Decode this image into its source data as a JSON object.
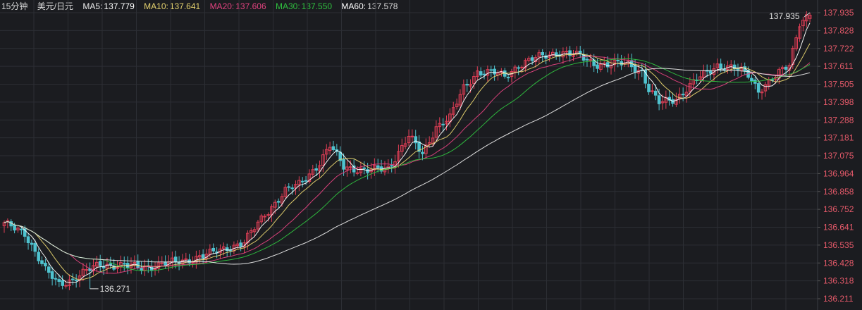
{
  "header": {
    "period": "15分钟",
    "instrument": "美元/日元",
    "ma": [
      {
        "label": "MA5:",
        "value": "137.779",
        "color": "#ffffff"
      },
      {
        "label": "MA10:",
        "value": "137.641",
        "color": "#e6d36f"
      },
      {
        "label": "MA20:",
        "value": "137.606",
        "color": "#e0427e"
      },
      {
        "label": "MA30:",
        "value": "137.550",
        "color": "#2fbf3f"
      },
      {
        "label": "MA60:",
        "value": "137.578",
        "color": "#ffffff"
      }
    ]
  },
  "colors": {
    "background": "#1b1c20",
    "grid": "#2c2e34",
    "up": "#e03e56",
    "down": "#4fc3cf",
    "axis_text": "#e65a6a",
    "ma5": "#ffffff",
    "ma10": "#e6d36f",
    "ma20": "#e0427e",
    "ma30": "#2fbf3f",
    "ma60": "#e8e8e8"
  },
  "chart_data": {
    "type": "candlestick",
    "ylim": [
      136.211,
      137.935
    ],
    "y_ticks": [
      "137.935",
      "137.828",
      "137.722",
      "137.611",
      "137.505",
      "137.398",
      "137.288",
      "137.181",
      "137.075",
      "136.964",
      "136.858",
      "136.752",
      "136.641",
      "136.535",
      "136.428",
      "136.318",
      "136.211"
    ],
    "annotations": [
      {
        "text": "137.935",
        "kind": "max"
      },
      {
        "text": "136.271",
        "kind": "min"
      }
    ],
    "grid": true
  }
}
